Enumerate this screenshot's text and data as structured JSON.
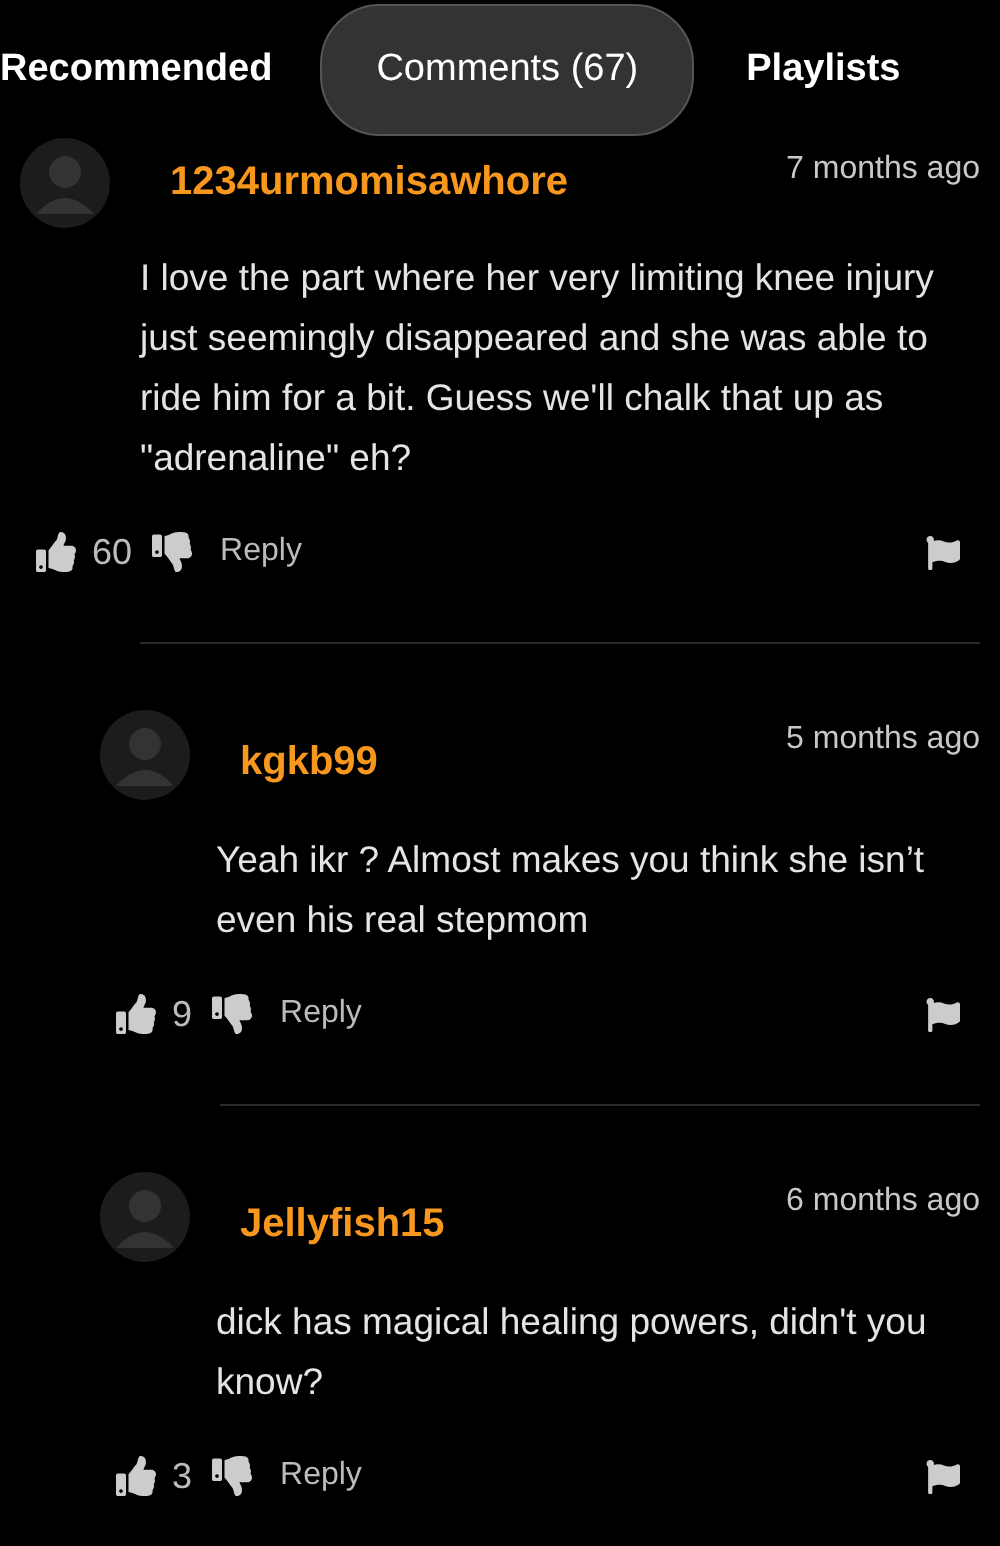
{
  "tabs": [
    {
      "label": "Recommended",
      "selected": false
    },
    {
      "label": "Comments (67)",
      "selected": true
    },
    {
      "label": "Playlists",
      "selected": false
    }
  ],
  "comments": [
    {
      "author": "1234urmomisawhore",
      "time": "7 months ago",
      "text": "I love the part where her very limiting knee injury just seemingly disappeared and she was able to ride him for a bit. Guess we'll chalk that up as \"adrenaline\" eh?",
      "likes": "60",
      "reply": "Reply",
      "children": [
        {
          "author": "kgkb99",
          "time": "5 months ago",
          "text": "Yeah ikr ? Almost makes you think she isn’t even his real stepmom",
          "likes": "9",
          "reply": "Reply"
        },
        {
          "author": "Jellyfish15",
          "time": "6 months ago",
          "text": "dick has magical healing powers, didn't you know?",
          "likes": "3",
          "reply": "Reply"
        }
      ]
    }
  ]
}
